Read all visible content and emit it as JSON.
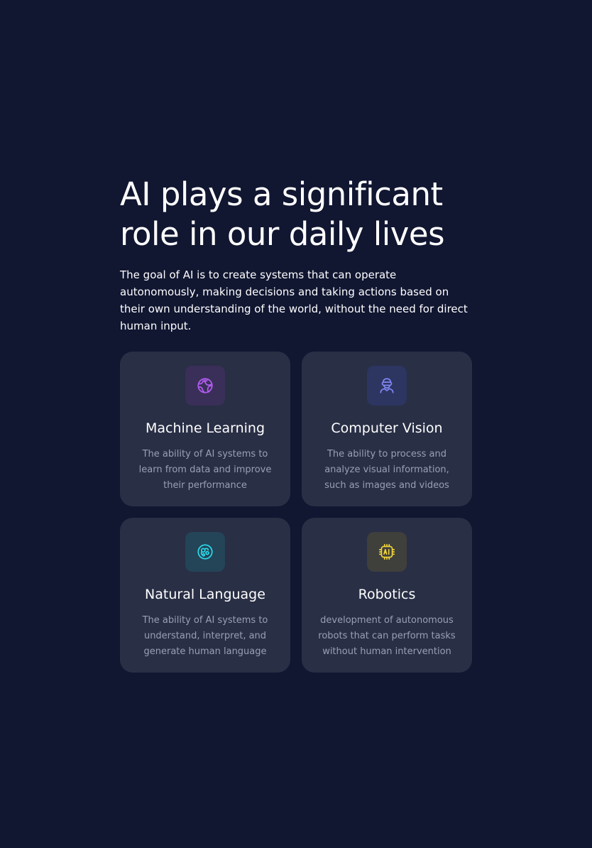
{
  "hero": {
    "title_line1": "AI plays a significant",
    "title_line2": "role in our daily lives",
    "description": "The goal of AI is to create systems that can operate autonomously, making decisions and taking actions based on their own understanding of the world, without the need for direct human input."
  },
  "features": [
    {
      "title": "Machine Learning",
      "description": "The ability of AI systems to learn from data and improve their performance",
      "icon": "globe-icon",
      "accent": "#b25cf0",
      "tile": "#3a2f59"
    },
    {
      "title": "Computer Vision",
      "description": "The ability to process and analyze visual information, such as images and videos",
      "icon": "vr-person-icon",
      "accent": "#7f86f2",
      "tile": "#2d3561"
    },
    {
      "title": "Natural Language",
      "description": "The ability of AI systems to understand, interpret, and generate human language",
      "icon": "brain-icon",
      "accent": "#2ad8e8",
      "tile": "#244457"
    },
    {
      "title": "Robotics",
      "description": "development of autonomous robots that can perform tasks without human intervention",
      "icon": "ai-chip-icon",
      "accent": "#f2d53a",
      "tile": "#3f3f3c"
    }
  ],
  "colors": {
    "background": "#111631",
    "card": "#292f45",
    "muted_text": "#9aa0b3"
  }
}
